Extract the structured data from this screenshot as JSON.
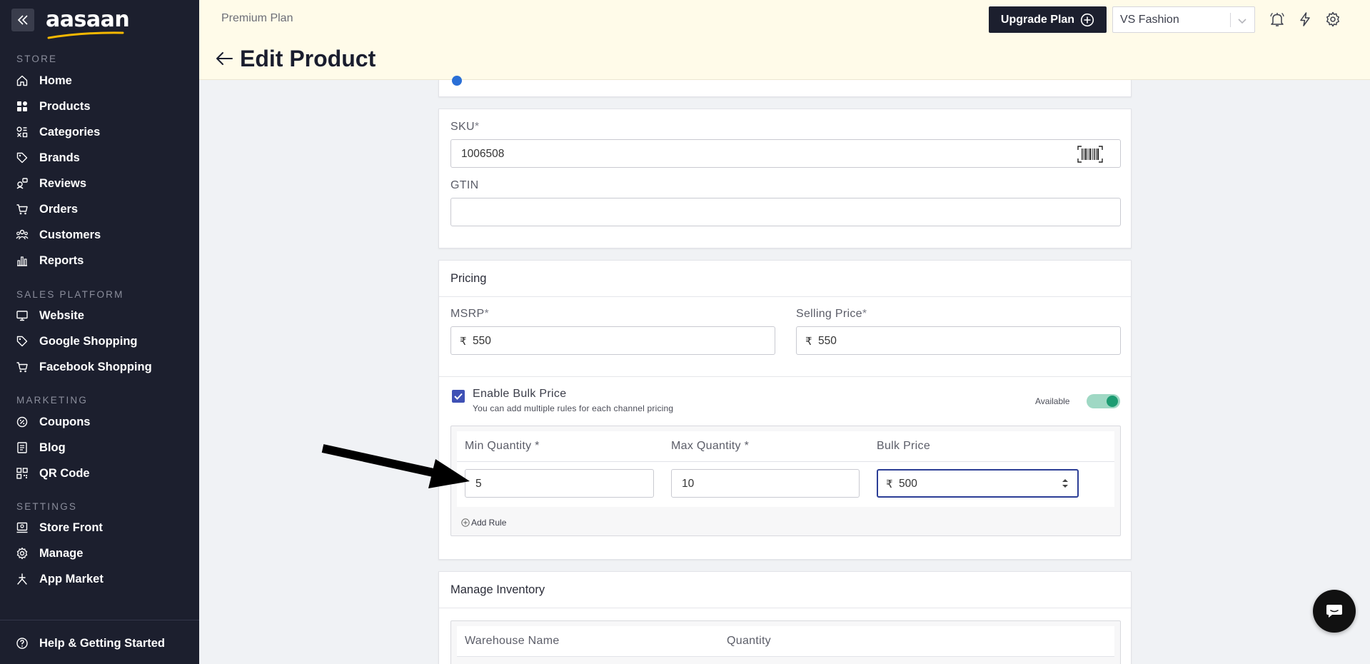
{
  "sidebar": {
    "logo": "aasaan",
    "sections": {
      "store": "STORE",
      "sales_platform": "SALES PLATFORM",
      "marketing": "MARKETING",
      "settings": "SETTINGS"
    },
    "items": {
      "home": "Home",
      "products": "Products",
      "categories": "Categories",
      "brands": "Brands",
      "reviews": "Reviews",
      "orders": "Orders",
      "customers": "Customers",
      "reports": "Reports",
      "website": "Website",
      "google_shopping": "Google Shopping",
      "facebook_shopping": "Facebook Shopping",
      "coupons": "Coupons",
      "blog": "Blog",
      "qr_code": "QR Code",
      "store_front": "Store Front",
      "manage": "Manage",
      "app_market": "App Market",
      "help": "Help & Getting Started"
    }
  },
  "header": {
    "plan": "Premium Plan",
    "title": "Edit Product",
    "upgrade_label": "Upgrade Plan",
    "store_name": "VS Fashion"
  },
  "identifiers": {
    "sku_label": "SKU",
    "sku_value": "1006508",
    "gtin_label": "GTIN",
    "gtin_value": ""
  },
  "pricing": {
    "title": "Pricing",
    "currency_symbol": "₹",
    "msrp_label": "MSRP",
    "msrp_value": "550",
    "selling_label": "Selling Price",
    "selling_value": "550",
    "bulk_label": "Enable Bulk Price",
    "bulk_hint": "You can add multiple rules for each channel pricing",
    "bulk_enabled": true,
    "available_label": "Available",
    "rules_headers": {
      "min": "Min Quantity",
      "max": "Max Quantity",
      "price": "Bulk Price"
    },
    "rules": [
      {
        "min": "5",
        "max": "10",
        "price": "500"
      }
    ],
    "add_rule_label": "Add Rule"
  },
  "inventory": {
    "title": "Manage Inventory",
    "col_warehouse": "Warehouse Name",
    "col_quantity": "Quantity"
  },
  "colors": {
    "sidebar_bg": "#1c1f2e",
    "header_bg": "#fffbe9",
    "accent": "#3f51b5",
    "toggle_on": "#1d9c72"
  }
}
